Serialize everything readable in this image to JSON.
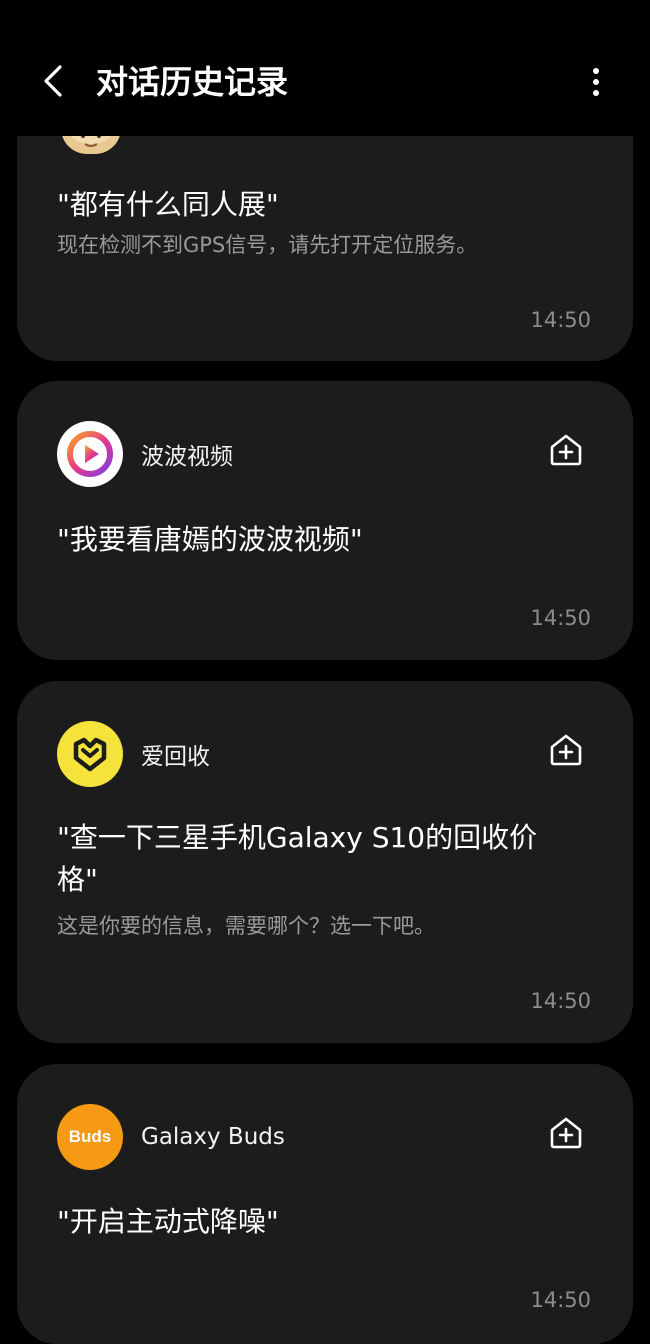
{
  "header": {
    "title": "对话历史记录",
    "back_icon": "chevron-left-icon",
    "more_icon": "more-vertical-icon"
  },
  "cards": [
    {
      "app_name": "",
      "avatar_icon": "cartoon-avatar-icon",
      "query": "\"都有什么同人展\"",
      "response": "现在检测不到GPS信号，请先打开定位服务。",
      "time": "14:50"
    },
    {
      "app_name": "波波视频",
      "app_icon": "bobo-video-icon",
      "query": "\"我要看唐嫣的波波视频\"",
      "response": "",
      "time": "14:50"
    },
    {
      "app_name": "爱回收",
      "app_icon": "aihuishou-icon",
      "query": "\"查一下三星手机Galaxy S10的回收价格\"",
      "response": "这是你要的信息，需要哪个？选一下吧。",
      "time": "14:50"
    },
    {
      "app_name": "Galaxy Buds",
      "app_icon_text": "Buds",
      "app_icon": "galaxy-buds-icon",
      "query": "\"开启主动式降噪\"",
      "response": "",
      "time": "14:50"
    }
  ],
  "colors": {
    "background": "#000000",
    "card": "#1c1c1c",
    "secondary_text": "#9a9a9a",
    "aihuishou_yellow": "#f5e23b",
    "buds_orange": "#f59a12"
  }
}
